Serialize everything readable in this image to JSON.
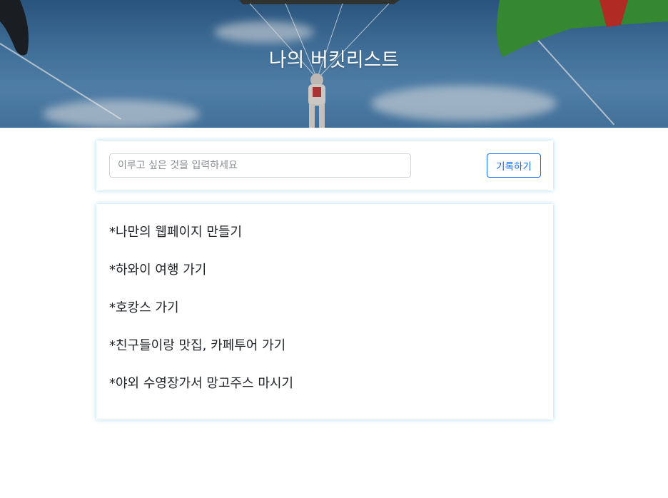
{
  "header": {
    "title": "나의 버킷리스트"
  },
  "form": {
    "input_placeholder": "이루고 싶은 것을 입력하세요",
    "input_value": "",
    "submit_label": "기록하기"
  },
  "bucket_list": {
    "items": [
      "*나만의 웹페이지 만들기",
      "*하와이 여행 가기",
      "*호캉스 가기",
      "*친구들이랑 맛집, 카페투어 가기",
      "*야외 수영장가서 망고주스 마시기"
    ]
  },
  "colors": {
    "accent": "#0d6efd",
    "card_glow": "#87ceeb"
  }
}
